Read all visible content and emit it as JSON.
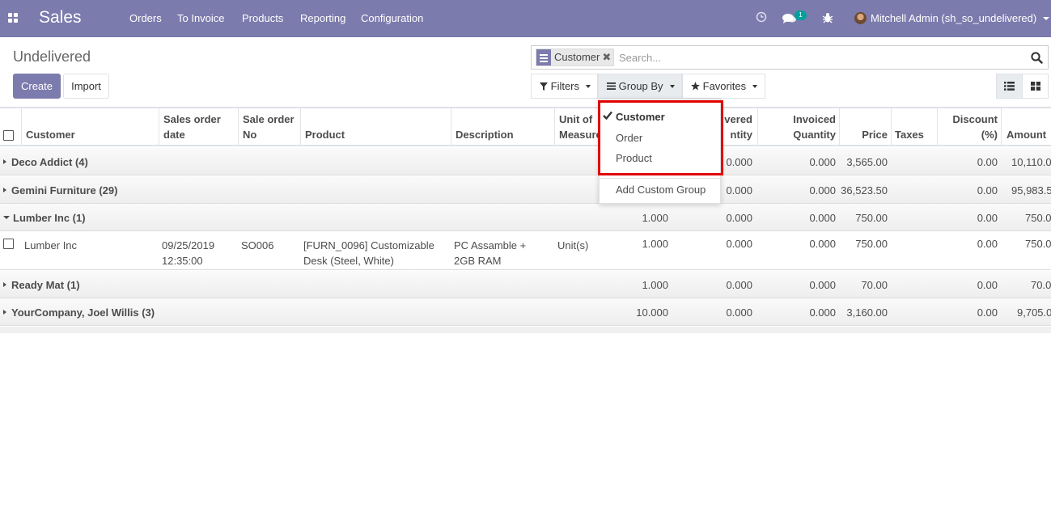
{
  "app": {
    "title": "Sales",
    "menu": [
      "Orders",
      "To Invoice",
      "Products",
      "Reporting",
      "Configuration"
    ],
    "chat_badge": "1",
    "user": "Mitchell Admin (sh_so_undelivered)"
  },
  "control_panel": {
    "title": "Undelivered",
    "create_label": "Create",
    "import_label": "Import",
    "facet_label": "Customer",
    "search_placeholder": "Search...",
    "filters_label": "Filters",
    "group_by_label": "Group By",
    "favorites_label": "Favorites"
  },
  "group_by_menu": {
    "items": [
      "Customer",
      "Order",
      "Product"
    ],
    "selected": "Customer",
    "add_custom": "Add Custom Group"
  },
  "table": {
    "headers": {
      "customer": "Customer",
      "sales_order_date": [
        "Sales order",
        "date"
      ],
      "sale_order_no": [
        "Sale order",
        "No"
      ],
      "product": "Product",
      "description": "Description",
      "unit_of_measure": [
        "Unit of",
        "Measure"
      ],
      "delivered_quantity": [
        "vered",
        "ntity"
      ],
      "invoiced_quantity": [
        "Invoiced",
        "Quantity"
      ],
      "price": "Price",
      "taxes": "Taxes",
      "discount": [
        "Discount",
        "(%)"
      ],
      "amount": "Amount"
    },
    "groups": [
      {
        "name": "Deco Addict (4)",
        "expanded": false,
        "ordered": "",
        "delivered": "0.000",
        "invoiced": "0.000",
        "price": "3,565.00",
        "discount": "0.00",
        "amount": "10,110.0"
      },
      {
        "name": "Gemini Furniture (29)",
        "expanded": false,
        "ordered": "",
        "delivered": "0.000",
        "invoiced": "0.000",
        "price": "36,523.50",
        "discount": "0.00",
        "amount": "95,983.5"
      },
      {
        "name": "Lumber Inc (1)",
        "expanded": true,
        "ordered": "1.000",
        "delivered": "0.000",
        "invoiced": "0.000",
        "price": "750.00",
        "discount": "0.00",
        "amount": "750.0"
      },
      {
        "name": "Ready Mat (1)",
        "expanded": false,
        "ordered": "1.000",
        "delivered": "0.000",
        "invoiced": "0.000",
        "price": "70.00",
        "discount": "0.00",
        "amount": "70.0"
      },
      {
        "name": "YourCompany, Joel Willis (3)",
        "expanded": false,
        "ordered": "10.000",
        "delivered": "0.000",
        "invoiced": "0.000",
        "price": "3,160.00",
        "discount": "0.00",
        "amount": "9,705.0"
      }
    ],
    "row": {
      "customer": "Lumber Inc",
      "date": [
        "09/25/2019",
        "12:35:00"
      ],
      "order_no": "SO006",
      "product": [
        "[FURN_0096] Customizable",
        "Desk (Steel, White)"
      ],
      "description": [
        "PC Assamble +",
        "2GB RAM"
      ],
      "uom": "Unit(s)",
      "ordered": "1.000",
      "delivered": "0.000",
      "invoiced": "0.000",
      "price": "750.00",
      "discount": "0.00",
      "amount": "750.0"
    }
  },
  "colors": {
    "brand": "#7c7bad",
    "highlight": "#e00000",
    "badge": "#00a09d"
  }
}
